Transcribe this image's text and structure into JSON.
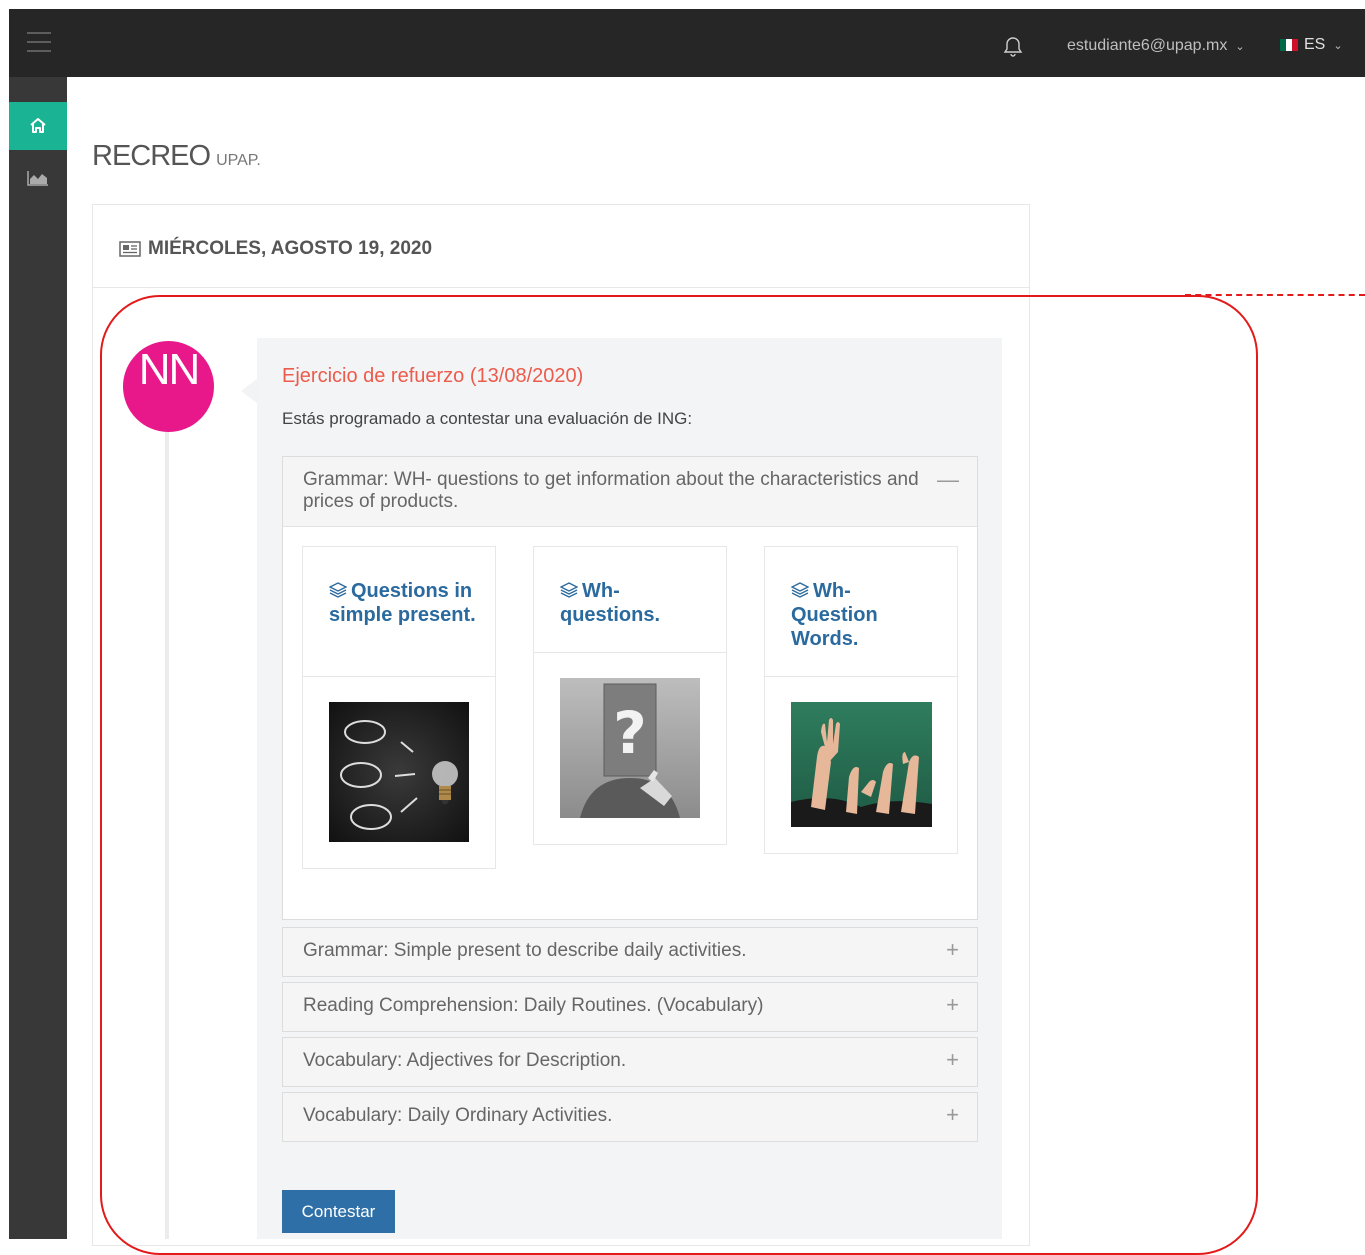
{
  "topbar": {
    "user_email": "estudiante6@upap.mx",
    "language": "ES",
    "icons": [
      "hamburger-icon",
      "bell-icon",
      "chevron-down-icon",
      "mexico-flag-icon"
    ]
  },
  "sidebar": {
    "items": [
      {
        "icon": "home-icon",
        "active": true
      },
      {
        "icon": "area-chart-icon",
        "active": false
      }
    ],
    "accent_color": "#1ab394"
  },
  "page": {
    "title": "RECREO",
    "subtitle": "UPAP."
  },
  "feed": {
    "date": "MIÉRCOLES, AGOSTO 19, 2020",
    "avatar_initials": "NN",
    "avatar_color": "#e8178a",
    "post": {
      "title": "Ejercicio de refuerzo (13/08/2020)",
      "description": "Estás programado a contestar una evaluación de ING:",
      "open_section": {
        "title": "Grammar: WH- questions to get information about the characteristics and prices of products.",
        "toggle": "—",
        "cards": [
          {
            "title": "Questions in simple present.",
            "image": "chalkboard-lightbulb"
          },
          {
            "title": "Wh- questions.",
            "image": "question-mark-face"
          },
          {
            "title": "Wh- Question Words.",
            "image": "raised-hands-classroom"
          }
        ]
      },
      "sections": [
        {
          "title": "Grammar: Simple present to describe daily activities.",
          "toggle": "+"
        },
        {
          "title": "Reading Comprehension: Daily Routines. (Vocabulary)",
          "toggle": "+"
        },
        {
          "title": "Vocabulary: Adjectives for Description.",
          "toggle": "+"
        },
        {
          "title": "Vocabulary: Daily Ordinary Activities.",
          "toggle": "+"
        }
      ],
      "button": "Contestar"
    }
  },
  "colors": {
    "post_title": "#ec5b4b",
    "card_title": "#2a6a9e",
    "button": "#2f6fa8",
    "annotation": "#e21a1a"
  }
}
